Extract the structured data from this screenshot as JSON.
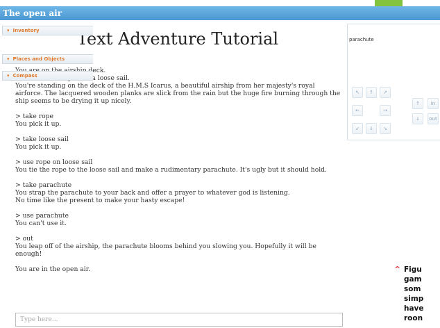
{
  "window": {
    "title": "The open air"
  },
  "main": {
    "heading": "Text Adventure Tutorial",
    "log": [
      [
        "You are on the airship deck.",
        "You can see a rope and a loose sail.",
        "You're standing on the deck of the H.M.S Icarus, a beautiful airship from her majesty's royal",
        "airforce. The lacquered wooden planks are slick from the rain but the huge fire burning through the",
        "ship seems to be drying it up nicely."
      ],
      [
        "> take rope",
        "You pick it up."
      ],
      [
        "> take loose sail",
        "You pick it up."
      ],
      [
        "> use rope on loose sail",
        "You tie the rope to the loose sail and make a rudimentary parachute. It's ugly but it should hold."
      ],
      [
        "> take parachute",
        "You strap the parachute to your back and offer a prayer to whatever god is listening.",
        "No time like the present to make your hasty escape!"
      ],
      [
        "> use parachute",
        "You can't use it."
      ],
      [
        "> out",
        "You leap off of the airship, the parachute blooms behind you slowing you. Hopefully it will be",
        "enough!"
      ],
      [
        "You are in the open air."
      ]
    ],
    "input": {
      "placeholder": "Type here..."
    }
  },
  "sidebar": {
    "inventory": {
      "label": "Inventory",
      "items": [
        "parachute"
      ]
    },
    "places": {
      "label": "Places and Objects"
    },
    "compass": {
      "label": "Compass",
      "buttons": [
        "↖",
        "↑",
        "↗",
        "←",
        "→",
        "↙",
        "↓",
        "↘",
        "↑",
        "in",
        "↓",
        "out"
      ]
    }
  },
  "caption": {
    "lines": [
      "Figu",
      "gam",
      "som",
      "simp",
      "have",
      "roon"
    ]
  },
  "colors": {
    "titlebar": "#4a97d1",
    "accent": "#e07a2d",
    "caption_marker": "#e2373c"
  }
}
